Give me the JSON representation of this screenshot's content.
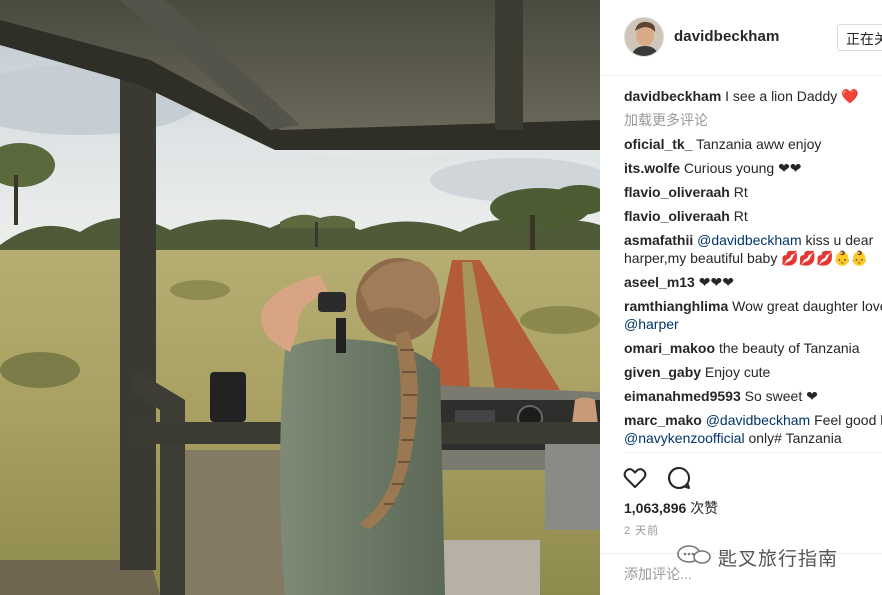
{
  "post": {
    "photo_alt": "Girl with binoculars standing in safari vehicle",
    "photo_label": ""
  },
  "header": {
    "username": "davidbeckham",
    "follow_button": "正在关注"
  },
  "caption": {
    "user": "davidbeckham",
    "text": "I see a lion Daddy ❤️"
  },
  "load_more": "加载更多评论",
  "comments": [
    {
      "user": "oficial_tk_",
      "parts": [
        {
          "t": "Tanzania aww enjoy"
        }
      ]
    },
    {
      "user": "its.wolfe",
      "parts": [
        {
          "t": "Curious young ❤❤"
        }
      ]
    },
    {
      "user": "flavio_oliveraah",
      "parts": [
        {
          "t": "Rt"
        }
      ]
    },
    {
      "user": "flavio_oliveraah",
      "parts": [
        {
          "t": "Rt"
        }
      ]
    },
    {
      "user": "asmafathii",
      "parts": [
        {
          "t": "@davidbeckham",
          "mention": true
        },
        {
          "t": " kiss u dear harper,my beautiful baby 💋💋💋👶👶"
        }
      ]
    },
    {
      "user": "aseel_m13",
      "parts": [
        {
          "t": "❤❤❤"
        }
      ]
    },
    {
      "user": "ramthianghlima",
      "parts": [
        {
          "t": "Wow great daughter love 😘😘"
        },
        {
          "t": "@harper",
          "mention": true
        }
      ]
    },
    {
      "user": "omari_makoo",
      "parts": [
        {
          "t": "the beauty of Tanzania"
        }
      ]
    },
    {
      "user": "given_gaby",
      "parts": [
        {
          "t": "Enjoy cute"
        }
      ]
    },
    {
      "user": "eimanahmed9593",
      "parts": [
        {
          "t": "So sweet ❤"
        }
      ]
    },
    {
      "user": "marc_mako",
      "parts": [
        {
          "t": "@davidbeckham",
          "mention": true
        },
        {
          "t": " Feel good like "
        },
        {
          "t": "@navykenzoofficial",
          "mention": true
        },
        {
          "t": " only# Tanzania"
        }
      ]
    }
  ],
  "actions": {
    "like_icon": "heart-outline-icon",
    "comment_icon": "speech-bubble-icon"
  },
  "likes": {
    "count": "1,063,896",
    "label": "次赞"
  },
  "time_ago": "2 天前",
  "add_comment": {
    "placeholder": "添加评论..."
  },
  "watermark": {
    "icon": "chat-bubbles-icon",
    "text": "匙叉旅行指南"
  },
  "colors": {
    "text": "#262626",
    "muted": "#999999",
    "mention": "#003569",
    "heart": "#ed4956"
  }
}
